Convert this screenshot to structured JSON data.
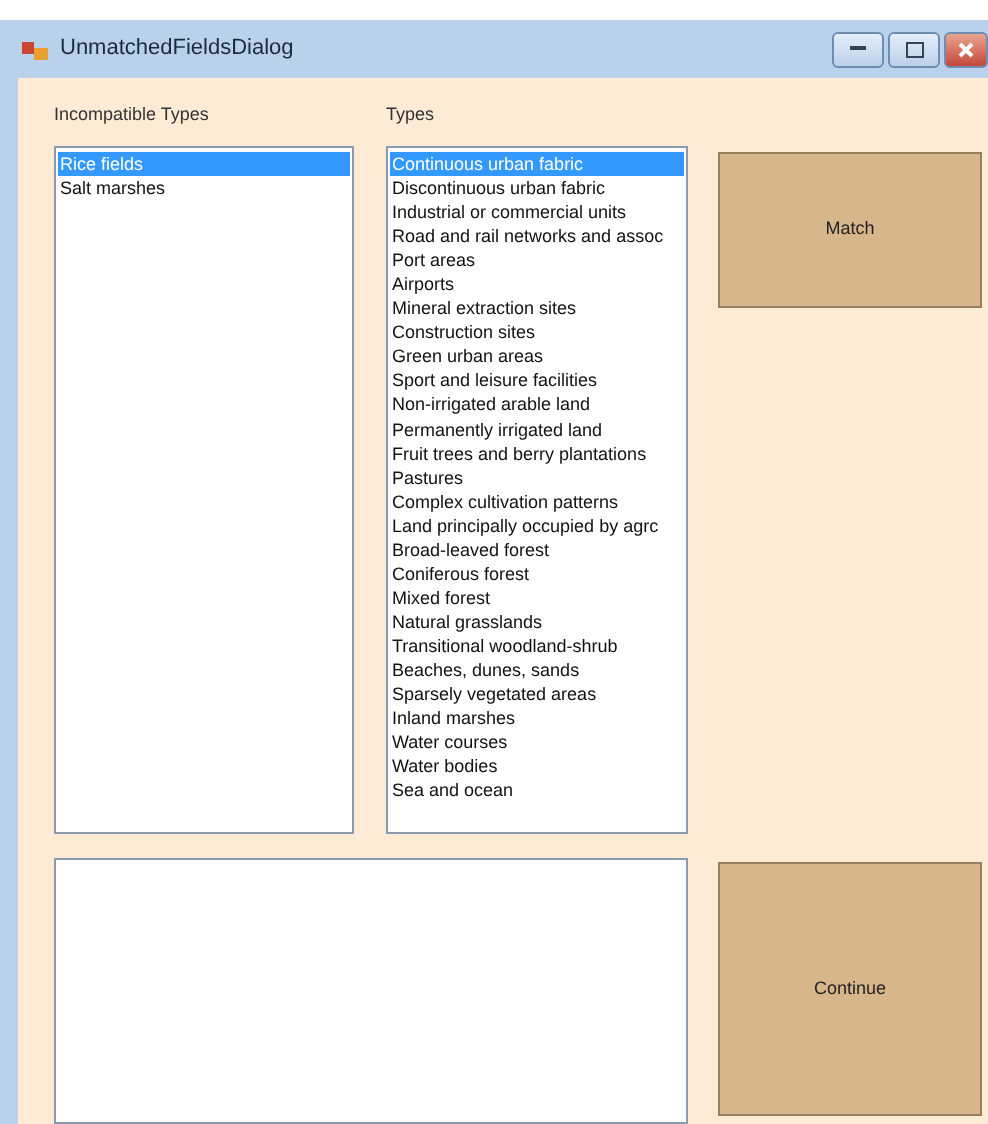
{
  "window": {
    "title": "UnmatchedFieldsDialog"
  },
  "incompatible_types": {
    "label": "Incompatible Types",
    "items": [
      {
        "text": "Rice fields",
        "selected": true
      },
      {
        "text": "Salt marshes",
        "selected": false
      }
    ]
  },
  "types": {
    "label": "Types",
    "items": [
      {
        "text": "Continuous urban fabric",
        "selected": true
      },
      {
        "text": "Discontinuous urban fabric",
        "selected": false
      },
      {
        "text": "Industrial or commercial units",
        "selected": false
      },
      {
        "text": "Road and rail networks and assoc",
        "selected": false
      },
      {
        "text": "Port areas",
        "selected": false
      },
      {
        "text": "Airports",
        "selected": false
      },
      {
        "text": "Mineral extraction sites",
        "selected": false
      },
      {
        "text": "Construction sites",
        "selected": false
      },
      {
        "text": "Green urban areas",
        "selected": false
      },
      {
        "text": "Sport and leisure facilities",
        "selected": false
      },
      {
        "text": "Non-irrigated arable land",
        "selected": false
      },
      {
        "text": "Permanently irrigated land",
        "selected": false
      },
      {
        "text": "Fruit trees and berry plantations",
        "selected": false
      },
      {
        "text": "Pastures",
        "selected": false
      },
      {
        "text": "Complex cultivation patterns",
        "selected": false
      },
      {
        "text": "Land principally occupied by agrc",
        "selected": false
      },
      {
        "text": "Broad-leaved forest",
        "selected": false
      },
      {
        "text": "Coniferous forest",
        "selected": false
      },
      {
        "text": "Mixed forest",
        "selected": false
      },
      {
        "text": "Natural grasslands",
        "selected": false
      },
      {
        "text": "Transitional woodland-shrub",
        "selected": false
      },
      {
        "text": "Beaches, dunes, sands",
        "selected": false
      },
      {
        "text": "Sparsely vegetated areas",
        "selected": false
      },
      {
        "text": "Inland marshes",
        "selected": false
      },
      {
        "text": "Water courses",
        "selected": false
      },
      {
        "text": "Water bodies",
        "selected": false
      },
      {
        "text": "Sea and ocean",
        "selected": false
      }
    ]
  },
  "buttons": {
    "match": "Match",
    "continue": "Continue"
  }
}
